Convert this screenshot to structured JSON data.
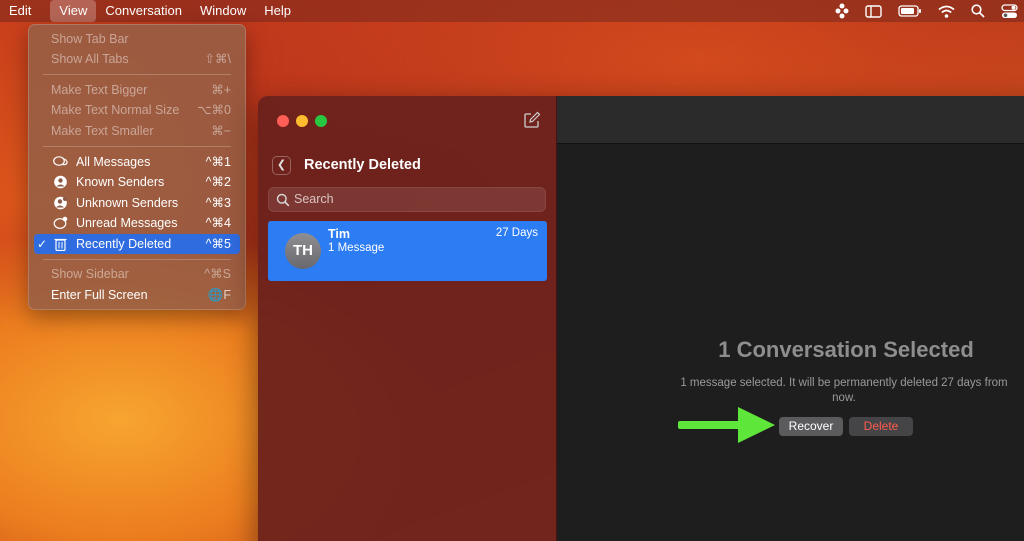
{
  "menubar": {
    "items": [
      "Edit",
      "View",
      "Conversation",
      "Window",
      "Help"
    ],
    "active_index": 1
  },
  "view_menu": {
    "items": [
      {
        "label": "Show Tab Bar",
        "shortcut": "",
        "disabled": true
      },
      {
        "label": "Show All Tabs",
        "shortcut": "⇧⌘\\",
        "disabled": true
      },
      {
        "label": "Make Text Bigger",
        "shortcut": "⌘+",
        "disabled": true
      },
      {
        "label": "Make Text Normal Size",
        "shortcut": "⌥⌘0",
        "disabled": true
      },
      {
        "label": "Make Text Smaller",
        "shortcut": "⌘−",
        "disabled": true
      },
      {
        "label": "All Messages",
        "shortcut": "^⌘1",
        "icon": "speech-bubbles-icon"
      },
      {
        "label": "Known Senders",
        "shortcut": "^⌘2",
        "icon": "person-circle-icon"
      },
      {
        "label": "Unknown Senders",
        "shortcut": "^⌘3",
        "icon": "person-question-icon"
      },
      {
        "label": "Unread Messages",
        "shortcut": "^⌘4",
        "icon": "unread-bubble-icon"
      },
      {
        "label": "Recently Deleted",
        "shortcut": "^⌘5",
        "icon": "trash-icon",
        "checked": true
      },
      {
        "label": "Show Sidebar",
        "shortcut": "^⌘S",
        "disabled": true
      },
      {
        "label": "Enter Full Screen",
        "shortcut": "🌐F"
      }
    ]
  },
  "sidebar": {
    "title": "Recently Deleted",
    "search_placeholder": "Search",
    "conversation": {
      "initials": "TH",
      "name": "Tim",
      "subtitle": "1 Message",
      "time": "27 Days"
    }
  },
  "main": {
    "title": "1 Conversation Selected",
    "description": "1 message selected. It will be permanently deleted 27 days from now.",
    "recover_label": "Recover",
    "delete_label": "Delete"
  },
  "colors": {
    "selection_blue": "#2f6ce0",
    "conversation_blue": "#2c7cf3",
    "arrow_green": "#5ee63a",
    "delete_red": "#ff5a4e"
  }
}
